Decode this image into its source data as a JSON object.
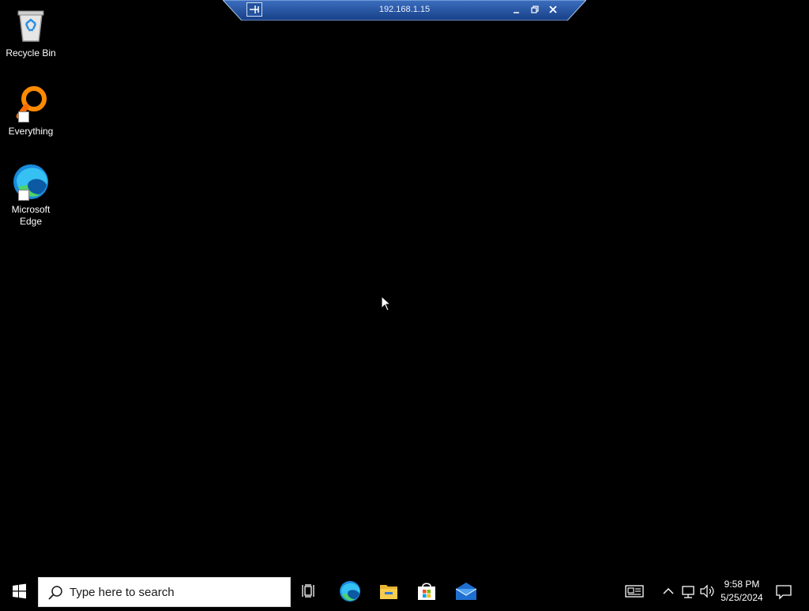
{
  "desktop": {
    "icons": [
      {
        "label": "Recycle Bin",
        "icon": "recycle-bin-icon"
      },
      {
        "label": "Everything",
        "icon": "everything-search-icon"
      },
      {
        "label": "Microsoft\nEdge",
        "icon": "edge-icon"
      }
    ]
  },
  "rdp_bar": {
    "title": "192.168.1.15",
    "pin_icon": "pin-icon",
    "minimize_icon": "minimize-icon",
    "restore_icon": "restore-icon",
    "close_icon": "close-icon"
  },
  "taskbar": {
    "search_placeholder": "Type here to search",
    "pinned_apps": [
      "task-view-icon",
      "edge-icon",
      "file-explorer-icon",
      "microsoft-store-icon",
      "mail-icon"
    ],
    "clock": {
      "time": "9:58 PM",
      "date": "5/25/2024"
    }
  },
  "colors": {
    "desktop_background": "#000000",
    "rdp_bar_blue": "#1f4f9e",
    "taskbar": "#000000"
  }
}
